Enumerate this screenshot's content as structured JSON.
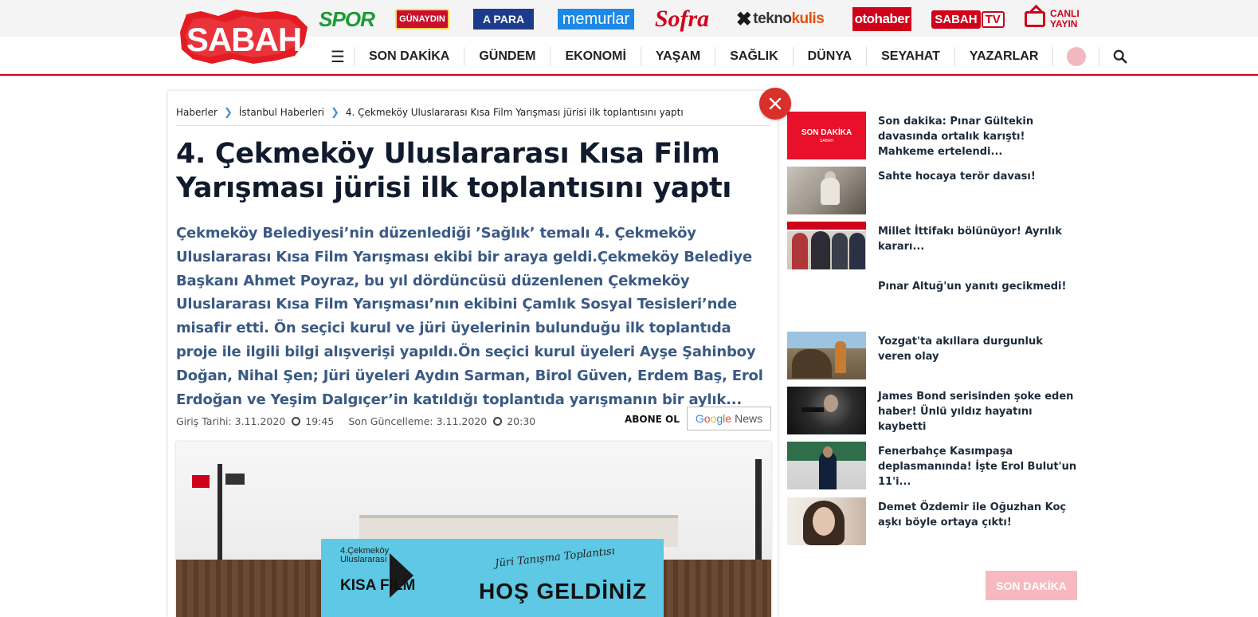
{
  "header": {
    "logo_text": "SABAH",
    "sites": {
      "spor": "SPOR",
      "gunaydin": "GÜNAYDIN",
      "apara": "A PARA",
      "memurlar": "memurlar",
      "sofra": "Sofra",
      "teknokulis_a": "tekno",
      "teknokulis_b": "kulis",
      "otohaber": "otohaber",
      "sabahtv_a": "SABAH",
      "sabahtv_b": "TV"
    },
    "canli_yayin_line1": "CANLI",
    "canli_yayin_line2": "YAYIN"
  },
  "nav": {
    "items": [
      "SON DAKİKA",
      "GÜNDEM",
      "EKONOMİ",
      "YAŞAM",
      "SAĞLIK",
      "DÜNYA",
      "SEYAHAT",
      "YAZARLAR"
    ]
  },
  "article": {
    "breadcrumb": [
      "Haberler",
      "İstanbul Haberleri",
      "4. Çekmeköy Uluslararası Kısa Film Yarışması jürisi ilk toplantısını yaptı"
    ],
    "title": "4. Çekmeköy Uluslararası Kısa Film Yarışması jürisi ilk toplantısını yaptı",
    "summary": "Çekmeköy Belediyesi’nin düzenlediği ’Sağlık’ temalı 4. Çekmeköy Uluslararası Kısa Film Yarışması ekibi bir araya geldi.Çekmeköy Belediye Başkanı Ahmet Poyraz, bu yıl dördüncüsü düzenlenen Çekmeköy Uluslararası Kısa Film Yarışması’nın ekibini Çamlık Sosyal Tesisleri’nde misafir etti. Ön seçici kurul ve jüri üyelerinin bulunduğu ilk toplantıda proje ile ilgili bilgi alışverişi yapıldı.Ön seçici kurul üyeleri Ayşe Şahinboy Doğan, Nihal Şen; Jüri üyeleri Aydın Sarman, Birol Güven, Erdem Baş, Erol Erdoğan ve Yeşim Dalgıçer’in katıldığı toplantıda yarışmanın bir aylık...",
    "giris_label": "Giriş Tarihi: 3.11.2020",
    "giris_time": "19:45",
    "guncelleme_label": "Son Güncelleme: 3.11.2020",
    "guncelleme_time": "20:30",
    "abone_label": "ABONE OL",
    "google_news": {
      "g1": "G",
      "g2": "o",
      "g3": "o",
      "g4": "g",
      "g5": "l",
      "g6": "e",
      "news": "News"
    },
    "photo": {
      "banner_left_line1": "4.Çekmeköy",
      "banner_left_line2": "Uluslararası",
      "banner_left_big": "KISA FILM",
      "banner_right_script": "Jüri Tanışma Toplantısı",
      "banner_right_big": "HOŞ GELDİNİZ"
    }
  },
  "sidebar": {
    "items": [
      {
        "title": "Son dakika: Pınar Gültekin davasında ortalık karıştı! Mahkeme ertelendi...",
        "thumb_text": "SON DAKİKA",
        "thumb_sub": "SABAH"
      },
      {
        "title": "Sahte hocaya terör davası!"
      },
      {
        "title": "Millet İttifakı bölünüyor! Ayrılık kararı..."
      },
      {
        "title": "Pınar Altuğ'un yanıtı gecikmedi!"
      },
      {
        "title": "Yozgat'ta akıllara durgunluk veren olay"
      },
      {
        "title": "James Bond serisinden şoke eden haber! Ünlü yıldız hayatını kaybetti"
      },
      {
        "title": "Fenerbahçe Kasımpaşa deplasmanında! İşte Erol Bulut'un 11'i..."
      },
      {
        "title": "Demet Özdemir ile Oğuzhan Koç aşkı böyle ortaya çıktı!"
      }
    ],
    "son_dakika_button": "SON DAKİKA"
  },
  "colors": {
    "brand_red": "#d0021b",
    "summary_blue": "#3a5a84",
    "close_red": "#d9302b"
  }
}
